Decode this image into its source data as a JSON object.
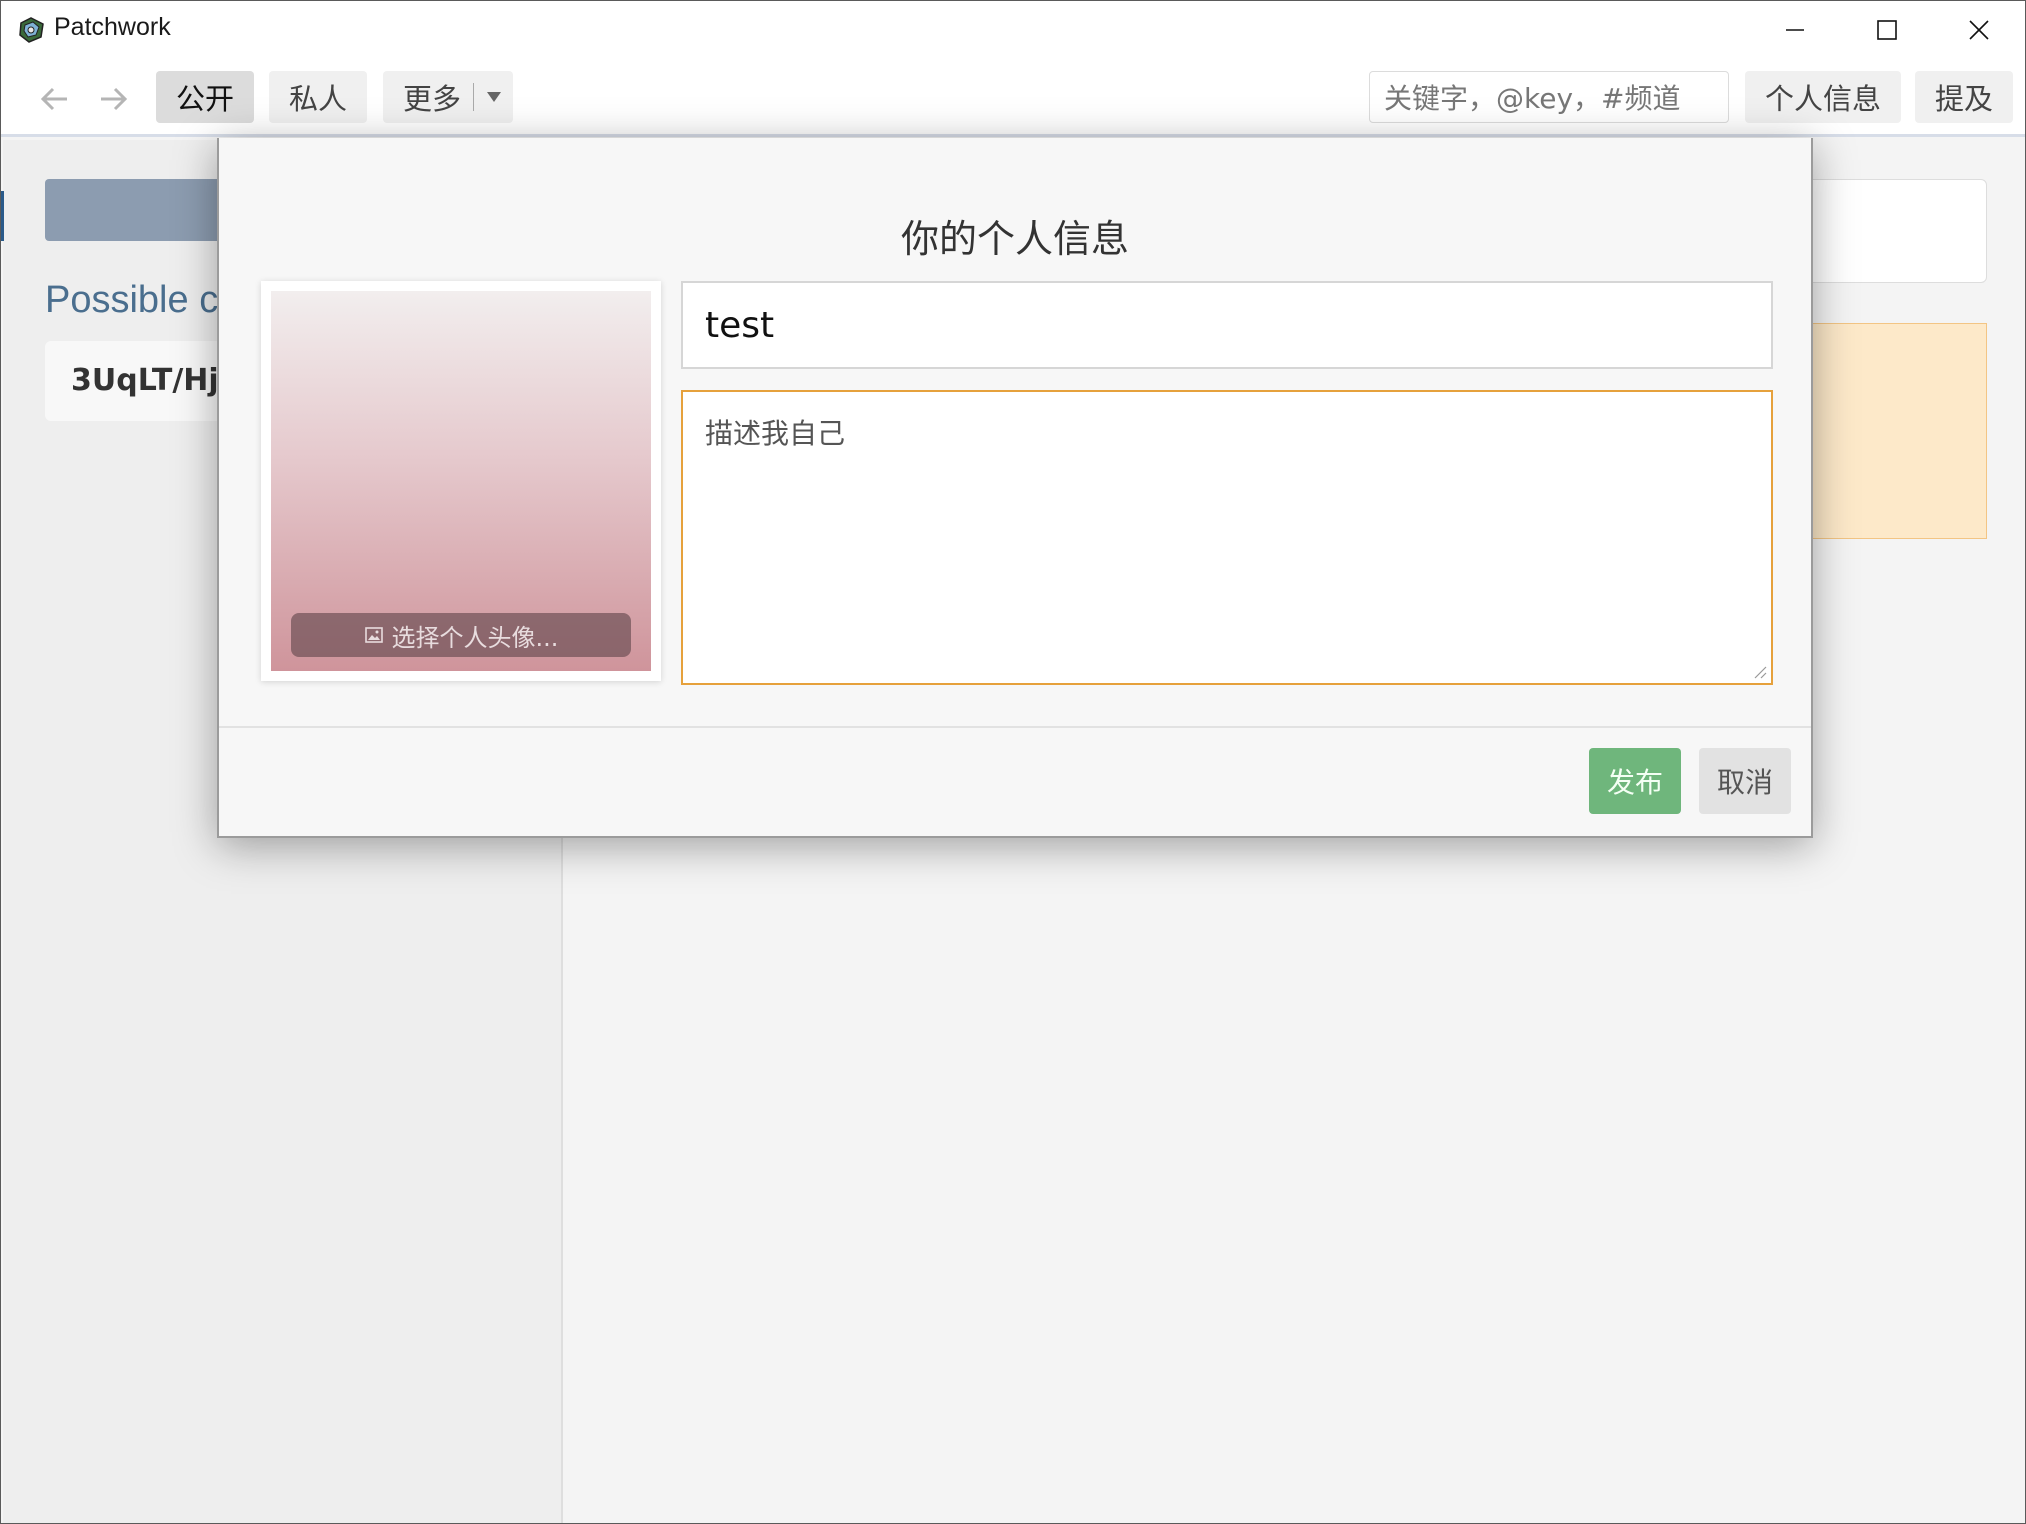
{
  "window": {
    "title": "Patchwork",
    "icon": "patchwork-logo-icon",
    "controls": [
      "minimize-icon",
      "maximize-icon",
      "close-icon"
    ]
  },
  "nav": {
    "back_icon": "arrow-left-icon",
    "forward_icon": "arrow-right-icon",
    "tabs": [
      {
        "label": "公开",
        "active": true
      },
      {
        "label": "私人",
        "active": false
      },
      {
        "label": "更多",
        "active": false
      }
    ],
    "search_placeholder": "关键字，@key，#频道",
    "profile_label": "个人信息",
    "mentions_label": "提及"
  },
  "background": {
    "heading": "Possible c",
    "card_text": "3UqLT/Hj"
  },
  "modal": {
    "title": "你的个人信息",
    "choose_avatar_label": "选择个人头像...",
    "name_value": "test",
    "description_placeholder": "描述我自己",
    "publish_label": "发布",
    "cancel_label": "取消"
  },
  "colors": {
    "accent_focus": "#e6a13c",
    "publish_green": "#6fb67c",
    "heading_blue": "#4a6e8e"
  }
}
